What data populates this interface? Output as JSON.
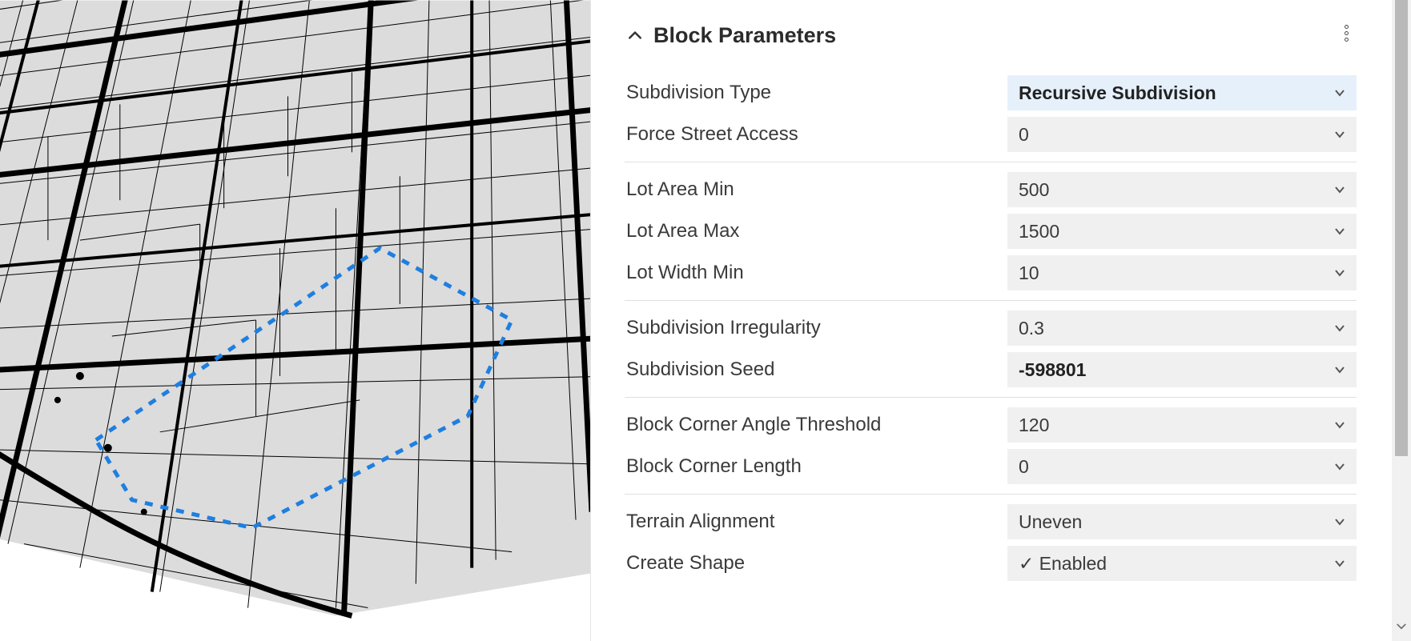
{
  "panel": {
    "title": "Block Parameters",
    "groups": [
      [
        {
          "label": "Subdivision Type",
          "value": "Recursive Subdivision",
          "highlight": true
        },
        {
          "label": "Force Street Access",
          "value": "0"
        }
      ],
      [
        {
          "label": "Lot Area Min",
          "value": "500"
        },
        {
          "label": "Lot Area Max",
          "value": "1500"
        },
        {
          "label": "Lot Width Min",
          "value": "10"
        }
      ],
      [
        {
          "label": "Subdivision Irregularity",
          "value": "0.3"
        },
        {
          "label": "Subdivision Seed",
          "value": "-598801",
          "bold": true
        }
      ],
      [
        {
          "label": "Block Corner Angle Threshold",
          "value": "120"
        },
        {
          "label": "Block Corner Length",
          "value": "0"
        }
      ],
      [
        {
          "label": "Terrain Alignment",
          "value": "Uneven"
        },
        {
          "label": "Create Shape",
          "value": "✓ Enabled"
        }
      ]
    ]
  }
}
